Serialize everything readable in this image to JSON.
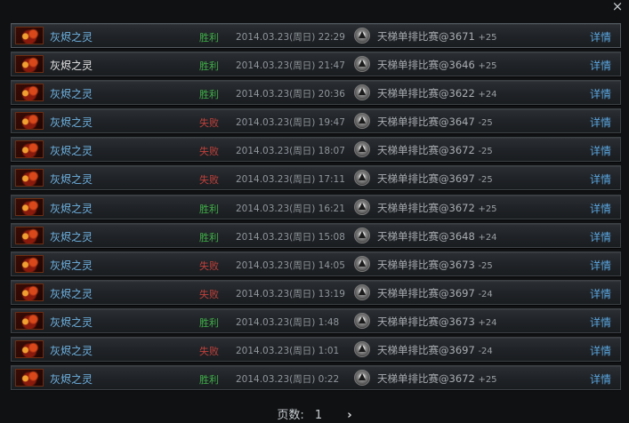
{
  "window": {
    "close_icon": "×"
  },
  "rows": [
    {
      "hero": "灰烬之灵",
      "result": "胜利",
      "result_type": "win",
      "time": "2014.03.23(周日) 22:29",
      "match": "天梯单排比赛@3671",
      "score": "+25",
      "detail": "详情",
      "highlight": false
    },
    {
      "hero": "灰烬之灵",
      "result": "胜利",
      "result_type": "win",
      "time": "2014.03.23(周日) 21:47",
      "match": "天梯单排比赛@3646",
      "score": "+25",
      "detail": "详情",
      "highlight": true
    },
    {
      "hero": "灰烬之灵",
      "result": "胜利",
      "result_type": "win",
      "time": "2014.03.23(周日) 20:36",
      "match": "天梯单排比赛@3622",
      "score": "+24",
      "detail": "详情",
      "highlight": false
    },
    {
      "hero": "灰烬之灵",
      "result": "失败",
      "result_type": "loss",
      "time": "2014.03.23(周日) 19:47",
      "match": "天梯单排比赛@3647",
      "score": "-25",
      "detail": "详情",
      "highlight": false
    },
    {
      "hero": "灰烬之灵",
      "result": "失败",
      "result_type": "loss",
      "time": "2014.03.23(周日) 18:07",
      "match": "天梯单排比赛@3672",
      "score": "-25",
      "detail": "详情",
      "highlight": false
    },
    {
      "hero": "灰烬之灵",
      "result": "失败",
      "result_type": "loss",
      "time": "2014.03.23(周日) 17:11",
      "match": "天梯单排比赛@3697",
      "score": "-25",
      "detail": "详情",
      "highlight": false
    },
    {
      "hero": "灰烬之灵",
      "result": "胜利",
      "result_type": "win",
      "time": "2014.03.23(周日) 16:21",
      "match": "天梯单排比赛@3672",
      "score": "+25",
      "detail": "详情",
      "highlight": false
    },
    {
      "hero": "灰烬之灵",
      "result": "胜利",
      "result_type": "win",
      "time": "2014.03.23(周日) 15:08",
      "match": "天梯单排比赛@3648",
      "score": "+24",
      "detail": "详情",
      "highlight": false
    },
    {
      "hero": "灰烬之灵",
      "result": "失败",
      "result_type": "loss",
      "time": "2014.03.23(周日) 14:05",
      "match": "天梯单排比赛@3673",
      "score": "-25",
      "detail": "详情",
      "highlight": false
    },
    {
      "hero": "灰烬之灵",
      "result": "失败",
      "result_type": "loss",
      "time": "2014.03.23(周日) 13:19",
      "match": "天梯单排比赛@3697",
      "score": "-24",
      "detail": "详情",
      "highlight": false
    },
    {
      "hero": "灰烬之灵",
      "result": "胜利",
      "result_type": "win",
      "time": "2014.03.23(周日) 1:48",
      "match": "天梯单排比赛@3673",
      "score": "+24",
      "detail": "详情",
      "highlight": false
    },
    {
      "hero": "灰烬之灵",
      "result": "失败",
      "result_type": "loss",
      "time": "2014.03.23(周日) 1:01",
      "match": "天梯单排比赛@3697",
      "score": "-24",
      "detail": "详情",
      "highlight": false
    },
    {
      "hero": "灰烬之灵",
      "result": "胜利",
      "result_type": "win",
      "time": "2014.03.23(周日) 0:22",
      "match": "天梯单排比赛@3672",
      "score": "+25",
      "detail": "详情",
      "highlight": false
    }
  ],
  "pager": {
    "label": "页数:",
    "current": "1",
    "next_icon": "›"
  },
  "colors": {
    "win": "#3fae48",
    "loss": "#c0413b",
    "link": "#5aa6e0",
    "hero_name": "#6fb3e3"
  }
}
